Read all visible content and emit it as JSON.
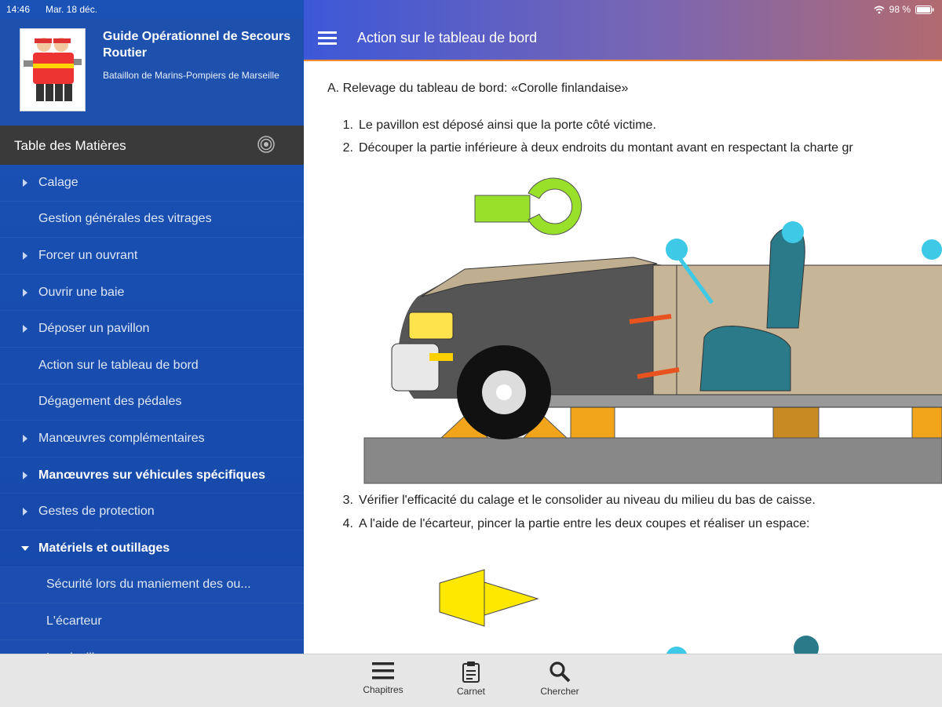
{
  "status_bar": {
    "time": "14:46",
    "date": "Mar. 18 déc.",
    "battery": "98 %"
  },
  "app": {
    "title": "Guide Opérationnel de Secours Routier",
    "subtitle": "Bataillon de Marins-Pompiers de Marseille"
  },
  "toc": {
    "header": "Table des Matières",
    "items": [
      {
        "label": "Calage",
        "arrow": "right"
      },
      {
        "label": "Gestion générales des vitrages",
        "arrow": "none"
      },
      {
        "label": "Forcer un ouvrant",
        "arrow": "right"
      },
      {
        "label": "Ouvrir une baie",
        "arrow": "right"
      },
      {
        "label": "Déposer un pavillon",
        "arrow": "right"
      },
      {
        "label": "Action sur le tableau de bord",
        "arrow": "none"
      },
      {
        "label": "Dégagement des pédales",
        "arrow": "none"
      },
      {
        "label": "Manœuvres complémentaires",
        "arrow": "right"
      },
      {
        "label": "Manœuvres sur véhicules spécifiques",
        "arrow": "right",
        "bold": true
      },
      {
        "label": "Gestes de protection",
        "arrow": "right"
      },
      {
        "label": "Matériels et outillages",
        "arrow": "down",
        "bold": true
      },
      {
        "label": "Sécurité lors du maniement des ou...",
        "arrow": "none",
        "sub": true
      },
      {
        "label": "L'écarteur",
        "arrow": "none",
        "sub": true
      },
      {
        "label": "La cisaille",
        "arrow": "none",
        "sub": true
      }
    ]
  },
  "header": {
    "title": "Action sur le tableau de bord"
  },
  "content": {
    "section": "A.  Relevage du tableau de bord: «Corolle finlandaise»",
    "steps": [
      {
        "num": "1.",
        "text": "Le pavillon est déposé ainsi que la porte côté victime."
      },
      {
        "num": "2.",
        "text": "Découper la partie inférieure à deux endroits du montant avant en respectant la charte gr"
      },
      {
        "num": "3.",
        "text": "Vérifier l'efficacité du calage et le consolider au niveau du milieu du bas de caisse."
      },
      {
        "num": "4.",
        "text": "A l'aide de l'écarteur, pincer la partie entre les deux coupes et réaliser un espace:"
      }
    ]
  },
  "bottom_tabs": [
    {
      "label": "Chapitres",
      "icon": "list-icon"
    },
    {
      "label": "Carnet",
      "icon": "clipboard-icon"
    },
    {
      "label": "Chercher",
      "icon": "search-icon"
    }
  ],
  "colors": {
    "sidebar": "#1a52b5",
    "toc_header": "#3a3a3a",
    "accent_line": "#f08a2a",
    "illustration_cutter": "#99e02a",
    "illustration_spreader": "#ffe800"
  }
}
